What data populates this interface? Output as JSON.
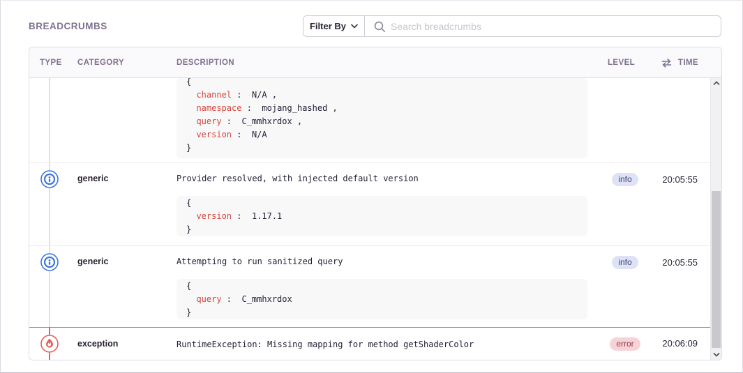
{
  "title": "BREADCRUMBS",
  "toolbar": {
    "filter_label": "Filter By",
    "search_placeholder": "Search breadcrumbs"
  },
  "table": {
    "headers": {
      "type": "TYPE",
      "category": "CATEGORY",
      "description": "DESCRIPTION",
      "level": "LEVEL",
      "time": "TIME"
    }
  },
  "rows": [
    {
      "variant": "partial",
      "code": {
        "entries": [
          {
            "key": "channel",
            "value": "N/A",
            "comma": true
          },
          {
            "key": "namespace",
            "value": "mojang_hashed",
            "comma": true
          },
          {
            "key": "query",
            "value": "C_mmhxrdox",
            "comma": true
          },
          {
            "key": "version",
            "value": "N/A",
            "comma": false
          }
        ]
      }
    },
    {
      "variant": "info",
      "icon": "info-icon",
      "category": "generic",
      "description": "Provider resolved, with injected default version",
      "code": {
        "entries": [
          {
            "key": "version",
            "value": "1.17.1",
            "comma": false
          }
        ]
      },
      "level": {
        "label": "info",
        "variant": "info"
      },
      "time": "20:05:55"
    },
    {
      "variant": "info",
      "icon": "info-icon",
      "category": "generic",
      "description": "Attempting to run sanitized query",
      "code": {
        "entries": [
          {
            "key": "query",
            "value": "C_mmhxrdox",
            "comma": false
          }
        ]
      },
      "level": {
        "label": "info",
        "variant": "info"
      },
      "time": "20:05:55"
    },
    {
      "variant": "error",
      "icon": "flame-icon",
      "category": "exception",
      "description": "RuntimeException: Missing mapping for method getShaderColor",
      "level": {
        "label": "error",
        "variant": "error"
      },
      "time": "20:06:09"
    }
  ],
  "colors": {
    "header_purple": "#80708f",
    "text_dark": "#2b2233",
    "info_blue": "#3c74dd",
    "error_red": "#e5605c",
    "code_key_red": "#d6453c",
    "code_value": "#232136",
    "code_bg": "#f8f8f9",
    "badge_info_bg": "#dde2f6",
    "badge_info_text": "#44466f",
    "badge_error_bg": "#f7d2d6",
    "badge_error_text": "#8f4049",
    "border": "#e0dce5",
    "timeline": "#e3dfe8"
  }
}
